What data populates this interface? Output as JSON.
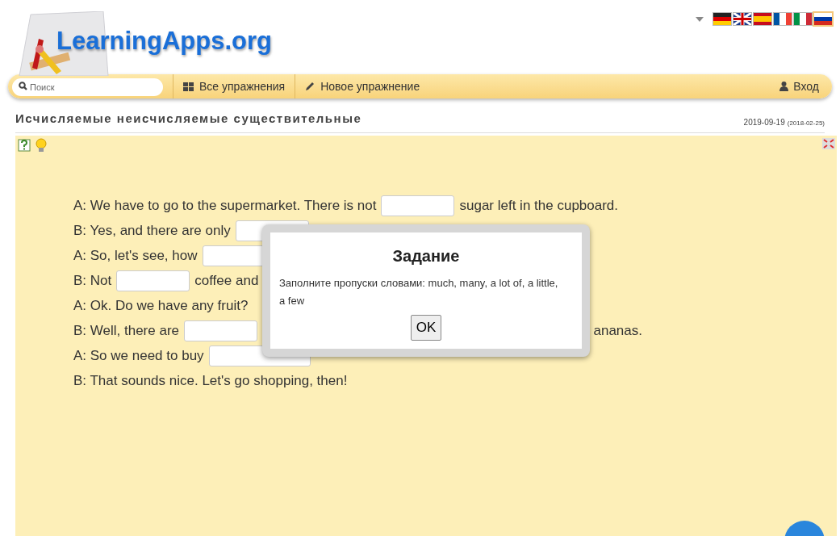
{
  "logo": {
    "text": "LearningApps.org"
  },
  "languages": [
    {
      "kind": "de",
      "selected": false
    },
    {
      "kind": "gb",
      "selected": false
    },
    {
      "kind": "es",
      "selected": false
    },
    {
      "kind": "fr",
      "selected": false
    },
    {
      "kind": "it",
      "selected": false
    },
    {
      "kind": "ru",
      "selected": true
    }
  ],
  "nav": {
    "search_placeholder": "Поиск",
    "items": [
      {
        "kind": "grid",
        "label": "Все упражнения"
      },
      {
        "kind": "pencil",
        "label": "Новое упражнение"
      }
    ],
    "login": "Вход"
  },
  "title": "Исчисляемые неисчисляемые существительные",
  "date": "2019-09-19",
  "date_created": "(2018-02-25)",
  "lines": [
    {
      "parts": [
        {
          "kind": "text",
          "text": "A: We have to go to the supermarket. There is not"
        },
        {
          "kind": "gap"
        },
        {
          "kind": "text",
          "text": "sugar left in the cupboard."
        }
      ]
    },
    {
      "parts": [
        {
          "kind": "text",
          "text": "B: Yes, and there are only"
        },
        {
          "kind": "gap"
        }
      ]
    },
    {
      "parts": [
        {
          "kind": "text",
          "text": "A: So, let's see, how"
        },
        {
          "kind": "gap"
        }
      ]
    },
    {
      "parts": [
        {
          "kind": "text",
          "text": "B: Not"
        },
        {
          "kind": "gap"
        },
        {
          "kind": "text",
          "text": "coffee and"
        }
      ]
    },
    {
      "parts": [
        {
          "kind": "text",
          "text": "A: Ok. Do we have any fruit?"
        }
      ]
    },
    {
      "parts": [
        {
          "kind": "text",
          "text": "B: Well, there are"
        },
        {
          "kind": "gap"
        },
        {
          "kind": "tail",
          "text": "ananas."
        }
      ]
    },
    {
      "parts": [
        {
          "kind": "text",
          "text": "A: So we need to buy"
        },
        {
          "kind": "longgap"
        }
      ]
    },
    {
      "parts": [
        {
          "kind": "text",
          "text": "B: That sounds nice. Let's go shopping, then!"
        }
      ]
    }
  ],
  "dialog": {
    "title": "Задание",
    "text": "Заполните пропуски словами: much, many, a lot of, a little, a few",
    "button": "OK"
  }
}
